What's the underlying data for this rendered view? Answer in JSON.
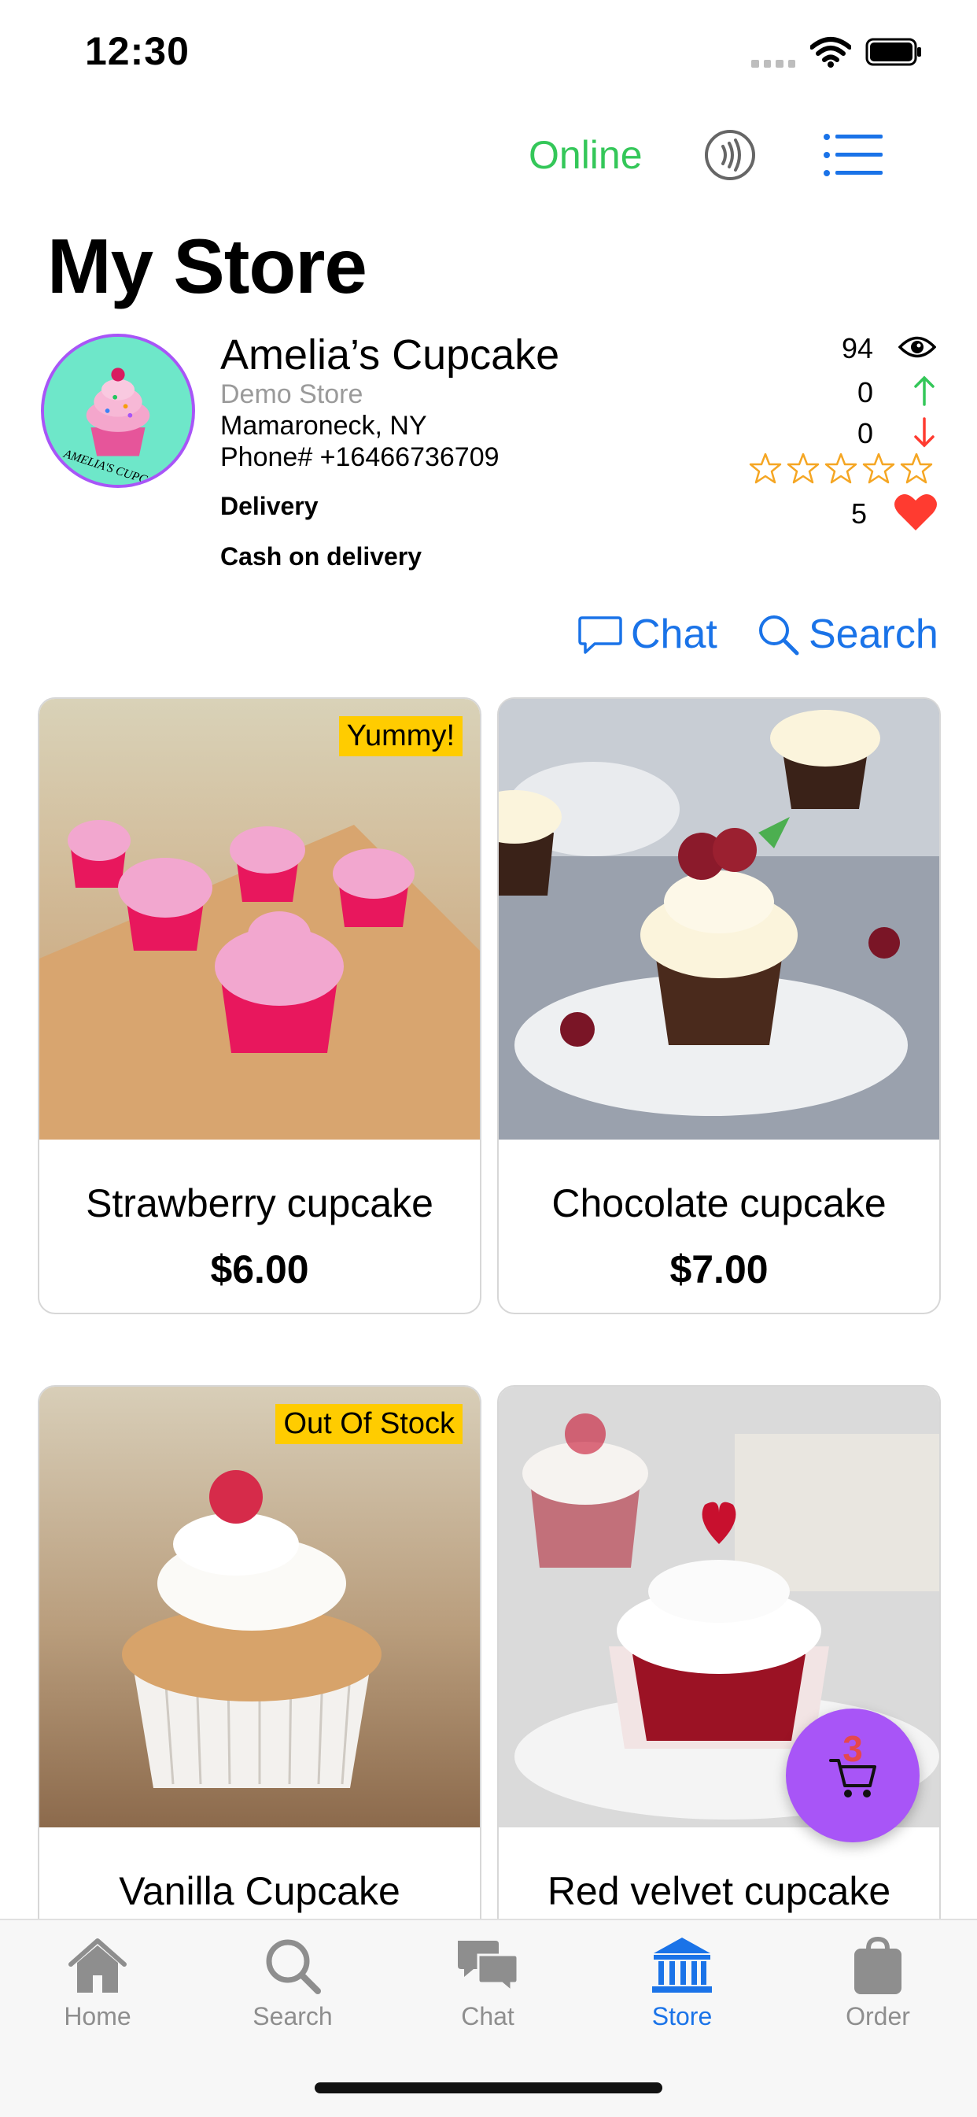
{
  "status_bar": {
    "time": "12:30"
  },
  "top_bar": {
    "status_label": "Online",
    "status_color": "#34c759"
  },
  "page": {
    "title": "My Store"
  },
  "store": {
    "name": "Amelia’s Cupcake",
    "subtitle": "Demo Store",
    "location": "Mamaroneck, NY",
    "phone": "Phone# +16466736709",
    "delivery_label": "Delivery",
    "payment_label": "Cash on delivery",
    "avatar_text": "AMELIA'S CUPCAKE",
    "stats": {
      "views": "94",
      "up": "0",
      "down": "0",
      "rating_stars": 0,
      "likes": "5"
    }
  },
  "actions": {
    "chat_label": "Chat",
    "search_label": "Search",
    "accent_color": "#1a73e8"
  },
  "products": [
    {
      "name": "Strawberry cupcake",
      "price": "$6.00",
      "badge": "Yummy!"
    },
    {
      "name": "Chocolate cupcake",
      "price": "$7.00",
      "badge": ""
    },
    {
      "name": "Vanilla Cupcake",
      "price": "",
      "badge": "Out Of Stock"
    },
    {
      "name": "Red velvet cupcake",
      "price": "",
      "badge": ""
    }
  ],
  "cart": {
    "count": "3",
    "color": "#a855f7"
  },
  "tabs": [
    {
      "label": "Home",
      "icon": "home-icon"
    },
    {
      "label": "Search",
      "icon": "search-icon"
    },
    {
      "label": "Chat",
      "icon": "chat-bubbles-icon"
    },
    {
      "label": "Store",
      "icon": "bank-icon",
      "active": true
    },
    {
      "label": "Order",
      "icon": "bag-icon"
    }
  ]
}
